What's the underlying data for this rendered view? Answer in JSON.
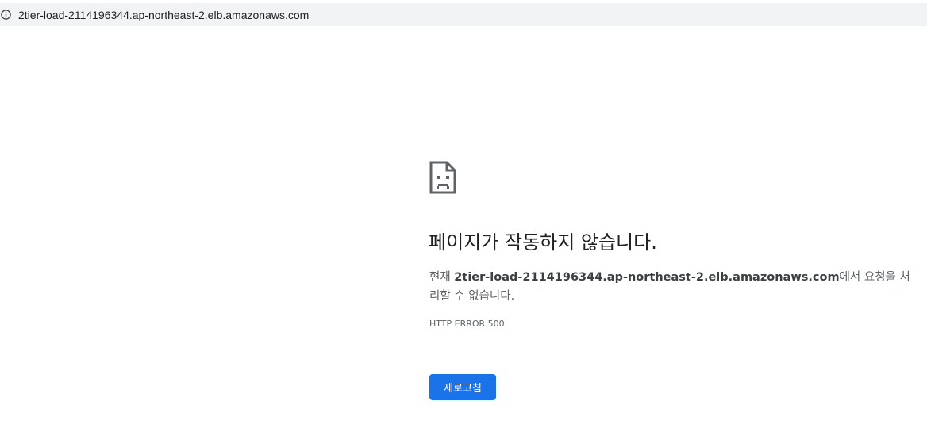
{
  "address_bar": {
    "url": "2tier-load-2114196344.ap-northeast-2.elb.amazonaws.com",
    "info_icon": "info-icon"
  },
  "error": {
    "icon": "sad-page-icon",
    "title": "페이지가 작동하지 않습니다.",
    "desc_prefix": "현재 ",
    "host": "2tier-load-2114196344.ap-northeast-2.elb.amazonaws.com",
    "desc_suffix": "에서 요청을 처리할 수 없습니다.",
    "code": "HTTP ERROR 500"
  },
  "reload_button": {
    "label": "새로고침"
  },
  "colors": {
    "accent": "#1a73e8",
    "text_primary": "#202124",
    "text_secondary": "#5f6368",
    "address_bar_bg": "#f1f3f4"
  }
}
